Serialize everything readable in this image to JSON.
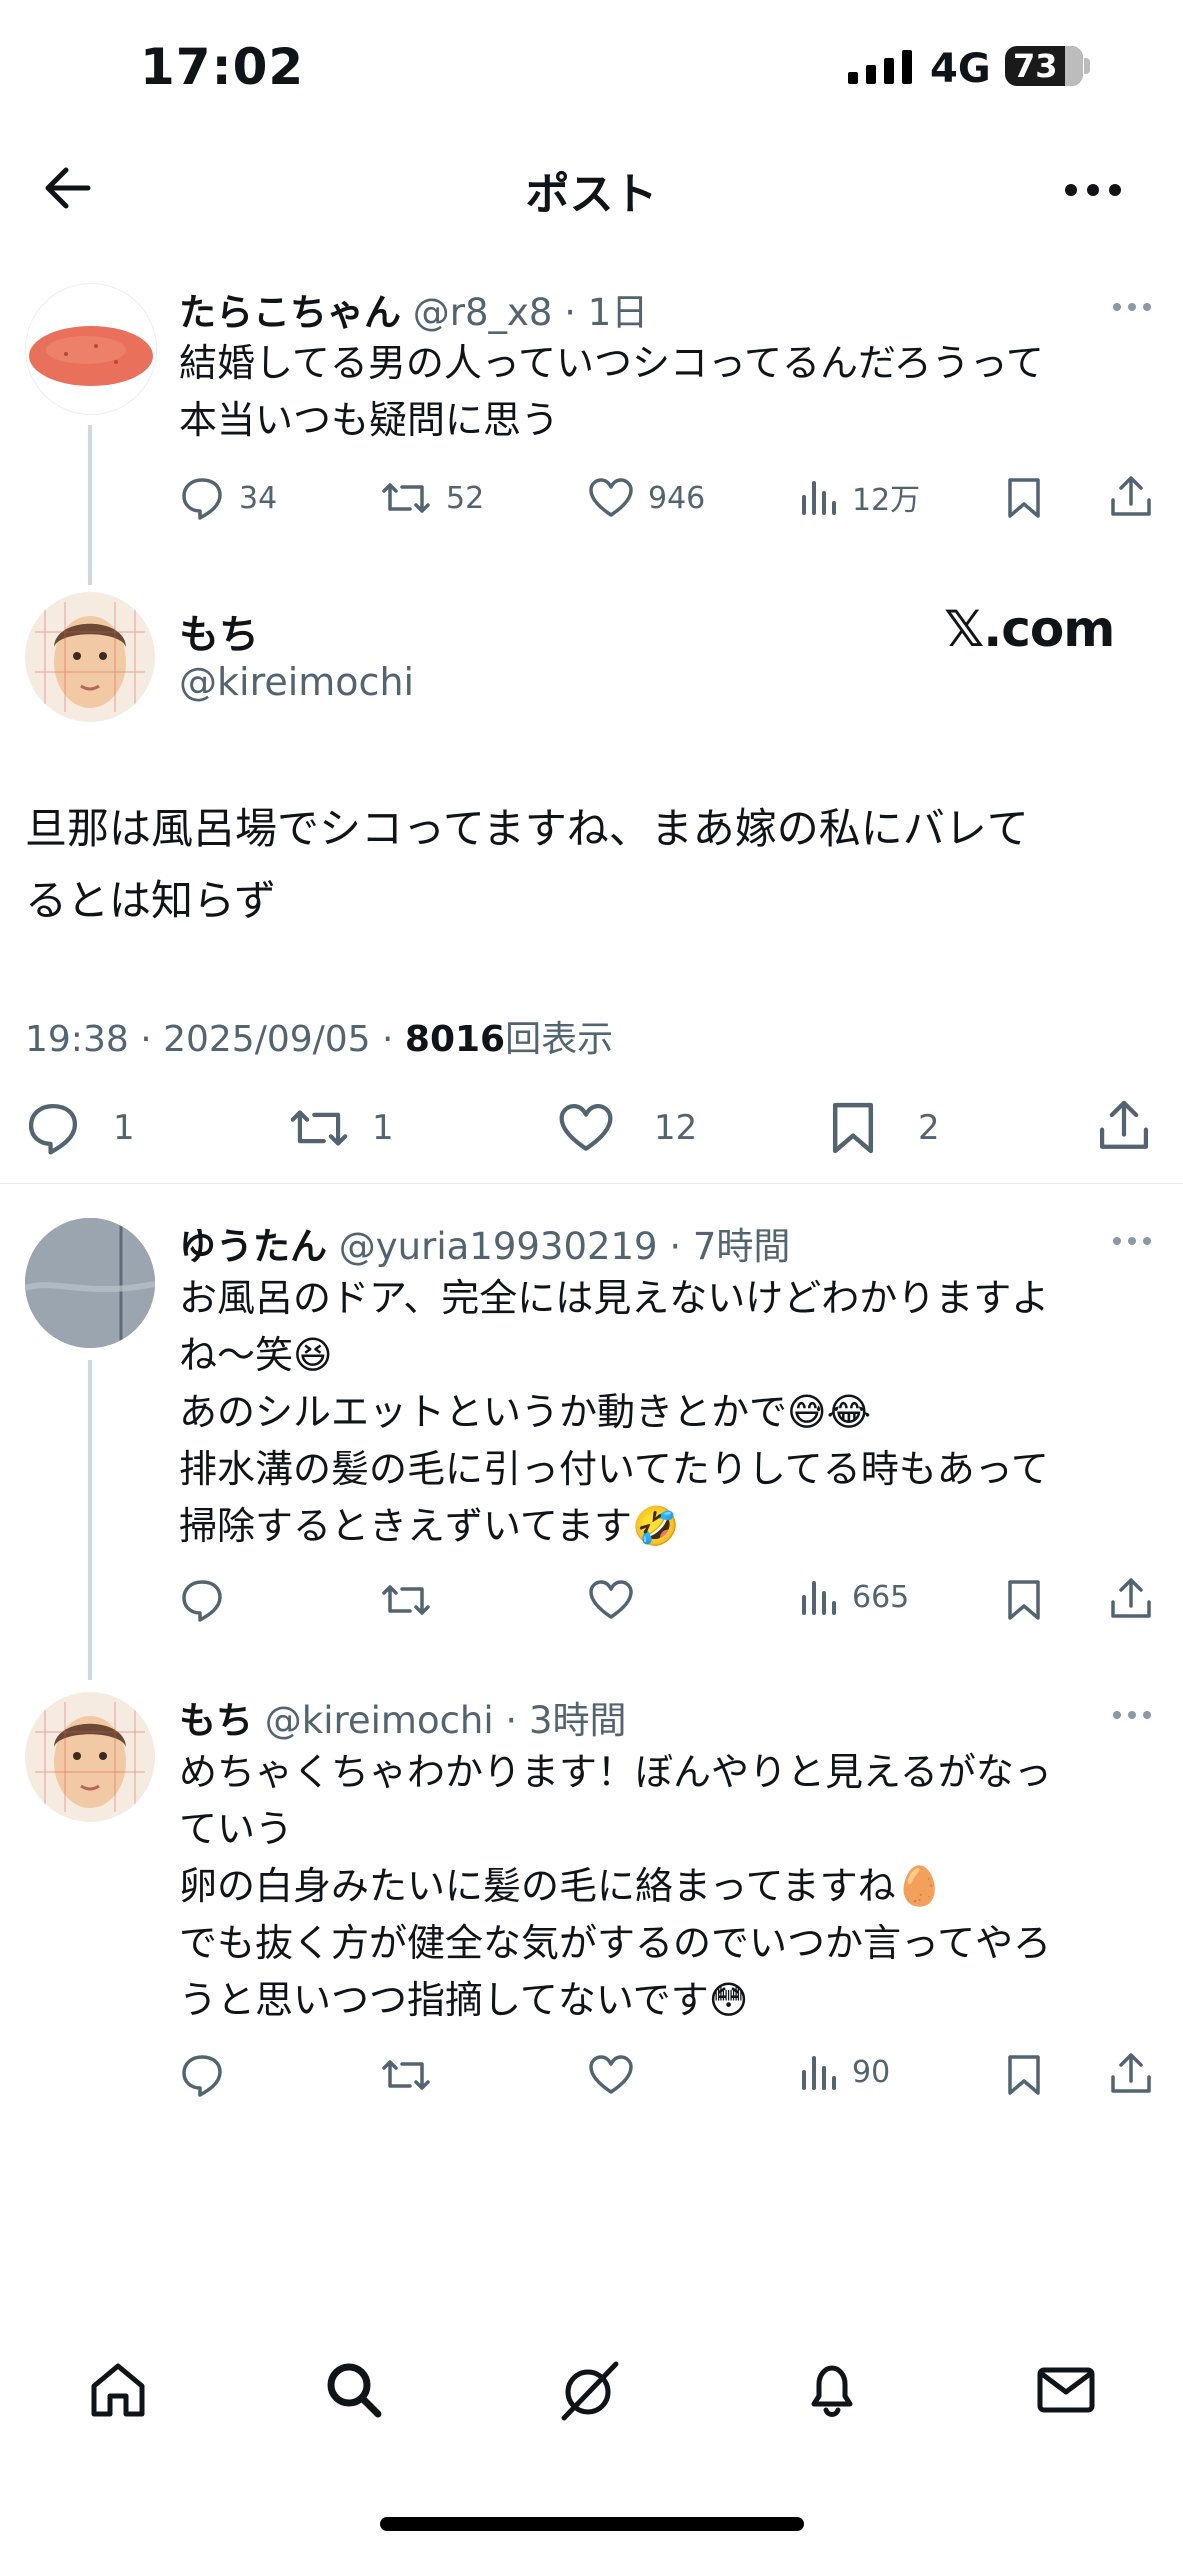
{
  "status_bar": {
    "time": "17:02",
    "network": "4G",
    "battery": "73"
  },
  "nav": {
    "title": "ポスト"
  },
  "tweets": [
    {
      "name": "たらこちゃん",
      "meta": "@r8_x8 · 1日",
      "lines": [
        "結婚してる男の人っていつシコってるんだろうって",
        "本当いつも疑問に思う"
      ],
      "actions": {
        "reply": "34",
        "retweet": "52",
        "like": "946",
        "views": "12万"
      }
    },
    {
      "name": "ゆうたん",
      "meta": "@yuria19930219 · 7時間",
      "lines": [
        "お風呂のドア、完全には見えないけどわかりますよ",
        "ね〜笑😆",
        "あのシルエットというか動きとかで😅😂",
        "排水溝の髪の毛に引っ付いてたりしてる時もあって",
        "掃除するときえずいてます🤣"
      ],
      "actions": {
        "views": "665"
      }
    },
    {
      "name": "もち",
      "meta": "@kireimochi · 3時間",
      "lines": [
        "めちゃくちゃわかります！ぼんやりと見えるがなっ",
        "ていう",
        "卵の白身みたいに髪の毛に絡まってますね🥚",
        "でも抜く方が健全な気がするのでいつか言ってやろ",
        "うと思いつつ指摘してないです😳"
      ],
      "actions": {
        "views": "90"
      }
    }
  ],
  "main": {
    "name": "もち",
    "handle": "@kireimochi",
    "source": "𝕏.com",
    "text_lines": [
      "旦那は風呂場でシコってますね、まあ嫁の私にバレて",
      "るとは知らず"
    ],
    "timestamp": "19:38 · 2025/09/05 · ",
    "views_count": "8016",
    "views_label": "回表示",
    "counts": {
      "reply": "1",
      "retweet": "1",
      "like": "12",
      "bookmark": "2"
    }
  },
  "tabbar": {
    "icons": [
      "home-icon",
      "search-icon",
      "grok-icon",
      "bell-icon",
      "mail-icon"
    ]
  },
  "colors": {
    "text": "#0f1419",
    "secondary": "#536471",
    "divider": "#e6ecf0",
    "thread": "#cfd9de"
  }
}
